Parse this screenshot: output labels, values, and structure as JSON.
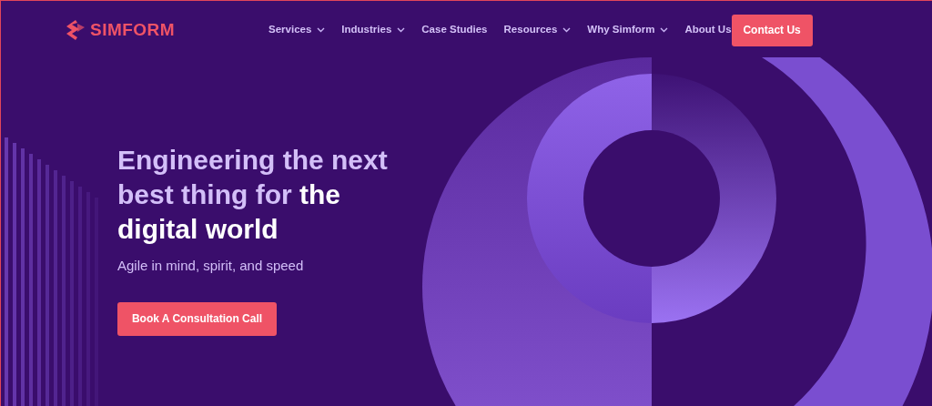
{
  "header": {
    "logo": "SIMFORM",
    "nav": [
      {
        "label": "Services",
        "dropdown": true
      },
      {
        "label": "Industries",
        "dropdown": true
      },
      {
        "label": "Case Studies",
        "dropdown": false
      },
      {
        "label": "Resources",
        "dropdown": true
      },
      {
        "label": "Why Simform",
        "dropdown": true
      },
      {
        "label": "About Us",
        "dropdown": false
      }
    ],
    "cta": "Contact Us"
  },
  "hero": {
    "headline": "Engineering the next best thing for **the digital world**",
    "subtitle": "Agile in mind, spirit, and speed",
    "button": "Book A Consultation Call"
  }
}
